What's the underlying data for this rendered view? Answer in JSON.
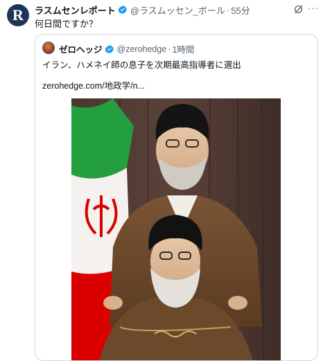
{
  "tweet": {
    "avatar_letter": "R",
    "author": "ラスムセンレポート",
    "handle": "@ラスムッセン_ボール",
    "time": "55分",
    "text": "何日間ですか？",
    "more_icon": "more-icon",
    "grok_icon": "grok-icon"
  },
  "quote": {
    "author": "ゼロヘッジ",
    "handle": "@zerohedge",
    "time": "1時間",
    "text": "イラン、ハメネイ師の息子を次期最高指導者に選出",
    "link": "zerohedge.com/地政学/n..."
  },
  "colors": {
    "verified": "#1d9bf0",
    "iran_green": "#239f40",
    "iran_red": "#da0000"
  }
}
